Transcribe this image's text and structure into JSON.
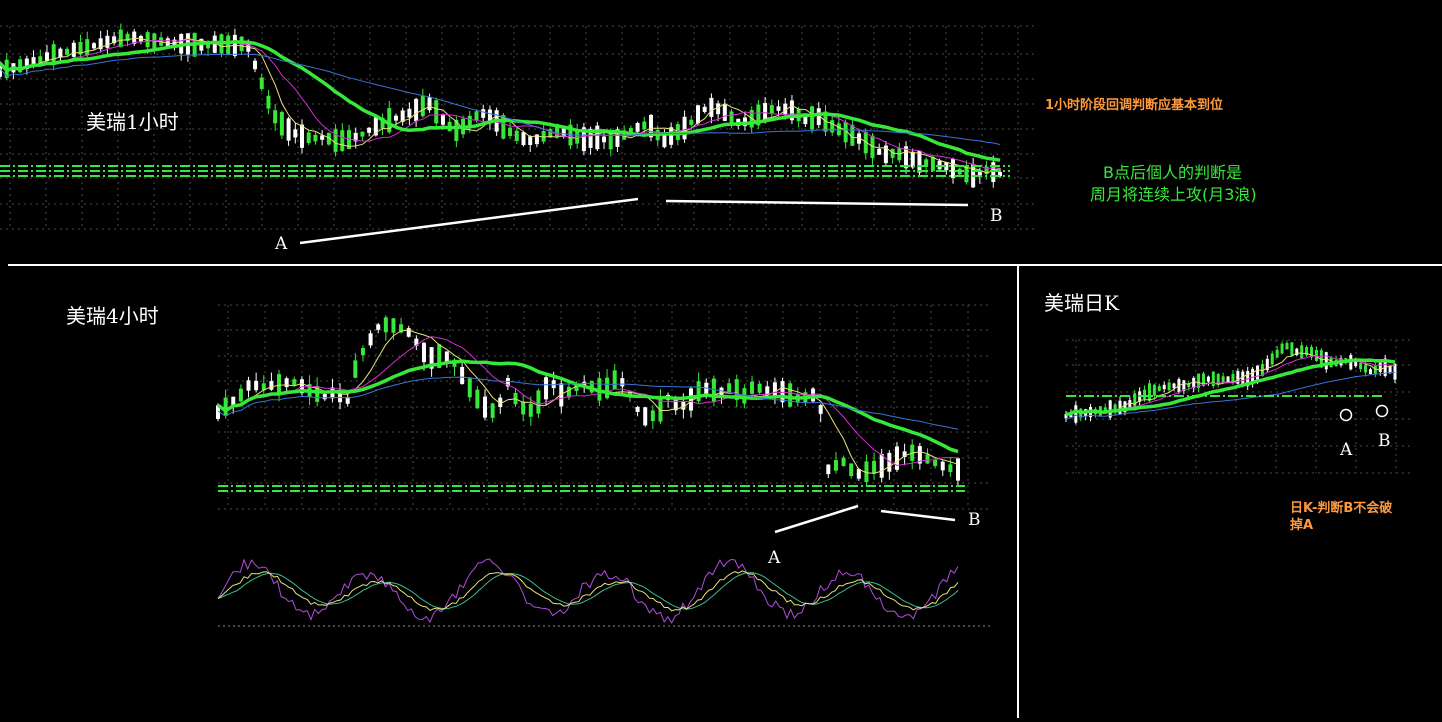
{
  "panels": {
    "h1": {
      "title": "美瑞1小时",
      "note": "1小时阶段回调判断应基本到位",
      "remark_line1": "B点后個人的判断是",
      "remark_line2": "周月将连续上攻(月3浪)",
      "marker_a": "A",
      "marker_b": "B"
    },
    "h4": {
      "title": "美瑞4小时",
      "marker_a": "A",
      "marker_b": "B"
    },
    "daily": {
      "title": "美瑞日K",
      "note_line1": "日K-判断B不会破",
      "note_line2": "掉A",
      "marker_a": "A",
      "marker_b": "B"
    }
  },
  "colors": {
    "up": "#ffffff",
    "down": "#37e83a",
    "ma_thick": "#37e83a",
    "ma_blue": "#3b73d8",
    "ma_magenta": "#d62bd6",
    "ma_yellow": "#e7e27a",
    "support": "#37e83a",
    "trend": "#ffffff"
  },
  "chart_data": [
    {
      "name": "h1",
      "type": "candlestick",
      "title": "美瑞1小时",
      "price_path": [
        62,
        60,
        56,
        52,
        46,
        44,
        40,
        38,
        34,
        30,
        28,
        30,
        32,
        34,
        35,
        36,
        36,
        35,
        37,
        34,
        70,
        108,
        122,
        130,
        133,
        132,
        136,
        134,
        128,
        120,
        114,
        110,
        104,
        96,
        112,
        126,
        118,
        106,
        112,
        124,
        132,
        136,
        130,
        124,
        130,
        134,
        132,
        136,
        130,
        122,
        118,
        136,
        128,
        120,
        104,
        100,
        108,
        118,
        112,
        104,
        102,
        104,
        114,
        110,
        120,
        126,
        132,
        140,
        150,
        148,
        154,
        158,
        160,
        162,
        168,
        172,
        166,
        170
      ],
      "support_levels": [
        0.62,
        0.7
      ],
      "annotations": [
        "1小时阶段回调判断应基本到位",
        "B点后個人的判断是",
        "周月将连续上攻(月3浪)"
      ]
    },
    {
      "name": "h4",
      "type": "candlestick",
      "title": "美瑞4小时",
      "price_path": [
        112,
        104,
        96,
        82,
        86,
        84,
        82,
        80,
        86,
        92,
        96,
        90,
        104,
        58,
        40,
        22,
        20,
        24,
        30,
        48,
        56,
        52,
        60,
        78,
        96,
        108,
        112,
        80,
        104,
        112,
        100,
        78,
        94,
        90,
        82,
        86,
        90,
        78,
        82,
        108,
        118,
        114,
        96,
        108,
        100,
        88,
        88,
        92,
        84,
        96,
        84,
        90,
        88,
        92,
        98,
        96,
        92,
        180,
        160,
        172,
        178,
        170,
        168,
        162,
        156,
        154,
        160,
        166,
        170,
        172
      ],
      "support_levels": [
        0.86
      ],
      "oscillator": "stochastic"
    },
    {
      "name": "daily",
      "type": "candlestick",
      "title": "美瑞日K",
      "price_path": [
        124,
        120,
        118,
        116,
        112,
        110,
        96,
        88,
        82,
        80,
        80,
        72,
        70,
        72,
        68,
        70,
        60,
        40,
        22,
        32,
        30,
        42,
        48,
        44,
        50,
        60,
        52,
        60
      ],
      "support_levels": [
        0.53
      ],
      "annotations": [
        "日K-判断B不会破",
        "掉A"
      ]
    }
  ]
}
